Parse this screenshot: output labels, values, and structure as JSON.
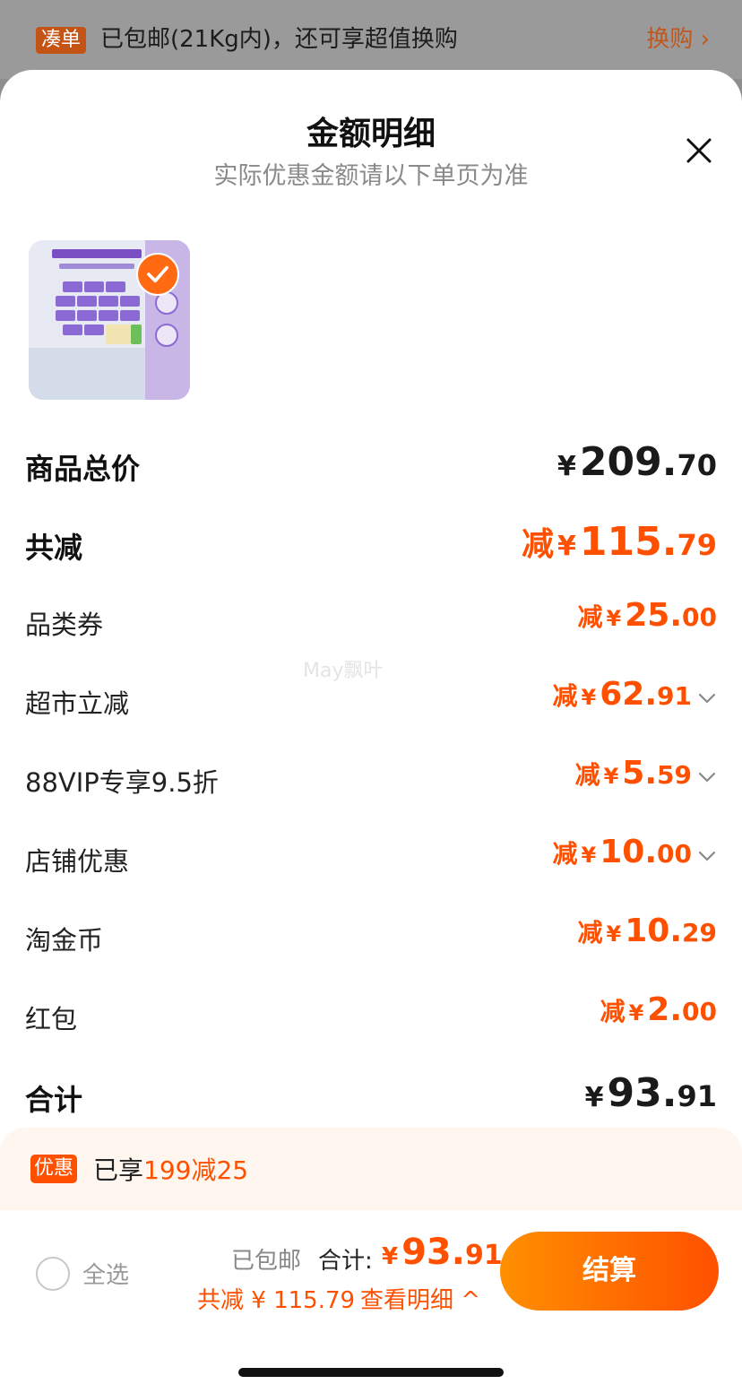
{
  "banner": {
    "tag": "凑单",
    "message": "已包邮(21Kg内)，还可享超值换购",
    "link": "换购 ›"
  },
  "sheet": {
    "title": "金额明细",
    "subtitle": "实际优惠金额请以下单页为准"
  },
  "product": {
    "image": "纸巾商品图",
    "selected": true
  },
  "rows": [
    {
      "label": "商品总价",
      "prefix": "",
      "currency": "¥",
      "int": "209.",
      "dec": "70",
      "expandable": false
    },
    {
      "label": "共减",
      "prefix": "减",
      "currency": "¥",
      "int": "115.",
      "dec": "79",
      "expandable": false
    },
    {
      "label": "品类券",
      "prefix": "减",
      "currency": "¥",
      "int": "25.",
      "dec": "00",
      "expandable": false
    },
    {
      "label": "超市立减",
      "prefix": "减",
      "currency": "¥",
      "int": "62.",
      "dec": "91",
      "expandable": true
    },
    {
      "label": "88VIP专享9.5折",
      "prefix": "减",
      "currency": "¥",
      "int": "5.",
      "dec": "59",
      "expandable": true
    },
    {
      "label": "店铺优惠",
      "prefix": "减",
      "currency": "¥",
      "int": "10.",
      "dec": "00",
      "expandable": true
    },
    {
      "label": "淘金币",
      "prefix": "减",
      "currency": "¥",
      "int": "10.",
      "dec": "29",
      "expandable": false
    },
    {
      "label": "红包",
      "prefix": "减",
      "currency": "¥",
      "int": "2.",
      "dec": "00",
      "expandable": false
    },
    {
      "label": "合计",
      "prefix": "",
      "currency": "¥",
      "int": "93.",
      "dec": "91",
      "expandable": false
    }
  ],
  "watermark": "May飘叶",
  "promo": {
    "tag": "优惠",
    "text": "已享",
    "highlight": "199减25"
  },
  "footer": {
    "select_all": "全选",
    "shipping": "已包邮",
    "total_label": "合计:",
    "total_currency": "¥",
    "total_int": "93.",
    "total_dec": "91",
    "savings": "共减 ¥ 115.79",
    "detail_link": "查看明细 ^",
    "checkout": "结算"
  },
  "colors": {
    "accent": "#ff5000",
    "gradient_start": "#ff9000",
    "promo_bg": "#fff7ef"
  }
}
